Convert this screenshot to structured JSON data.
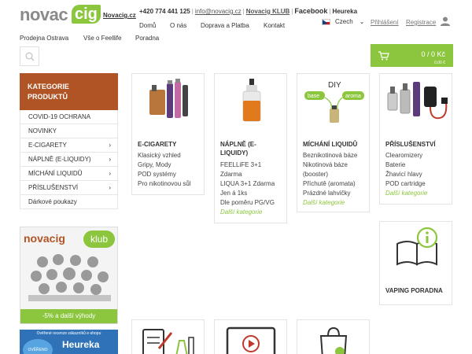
{
  "header": {
    "logo_text_a": "novac",
    "logo_text_b": "ig",
    "logo_caption": "Novacig.cz",
    "phone": "+420 774 441 125",
    "email": "info@novacig.cz",
    "klub_link": "Novacig KLUB",
    "facebook": "Facebook",
    "heureka": "Heureka",
    "nav": [
      "Domů",
      "O nás",
      "Doprava a Platba",
      "Kontakt"
    ],
    "subnav": [
      "Prodejna Ostrava",
      "Vše o Feellife",
      "Poradna"
    ],
    "language": "Czech",
    "login": "Přihlášení",
    "register": "Registrace",
    "cart_total": "0 / 0 Kč",
    "cart_sub": "0,00 €"
  },
  "sidebar": {
    "heading_line1": "KATEGORIE",
    "heading_line2": "PRODUKTŮ",
    "items": [
      {
        "label": "COVID-19 OCHRANA",
        "arrow": ""
      },
      {
        "label": "NOVINKY",
        "arrow": ""
      },
      {
        "label": "E-CIGARETY",
        "arrow": "›"
      },
      {
        "label": "NÁPLNĚ (E-LIQUIDY)",
        "arrow": "›"
      },
      {
        "label": "MÍCHÁNÍ LIQUIDŮ",
        "arrow": "›"
      },
      {
        "label": "PŘÍSLUŠENSTVÍ",
        "arrow": "›"
      },
      {
        "label": "Dárkové poukazy",
        "arrow": ""
      }
    ]
  },
  "banners": {
    "klub_logo": "novacig",
    "klub_pill": "klub",
    "klub_strip": "-5% a další výhody",
    "heureka_top": "Ověřené recenze zákazníků e-shopu",
    "heureka_name": "Heureka",
    "heureka_seal": "OVĚŘENO"
  },
  "cards": [
    {
      "title_line1": "E-CIGARETY",
      "title_line2": "",
      "items": [
        "Klasický vzhled",
        "Gripy, Mody",
        "POD systémy",
        "Pro nikotinovou sůl"
      ],
      "more": ""
    },
    {
      "title_line1": "NÁPLNĚ (E-",
      "title_line2": "LIQUIDY)",
      "items": [
        "FEELLiFE 3+1",
        "Zdarma",
        "LIQUA 3+1 Zdarma",
        "Jen á 1ks",
        "Dle poměru PG/VG"
      ],
      "more": "Další kategorie"
    },
    {
      "title_line1": "MÍCHÁNÍ LIQUIDŮ",
      "title_line2": "",
      "items": [
        "Beznikotinová báze",
        "Nikotinová báze",
        "(booster)",
        "Příchutě (aromata)",
        "Prázdné lahvičky"
      ],
      "more": "Další kategorie",
      "img_diy": "DIY",
      "img_base": "base",
      "img_aroma": "aroma"
    },
    {
      "title_line1": "PŘÍSLUŠENSTVÍ",
      "title_line2": "",
      "items": [
        "Clearomizery",
        "Baterie",
        "Žhavicí hlavy",
        "POD cartridge"
      ],
      "more": "Další kategorie"
    },
    {
      "title_line1": "VAPING PORADNA",
      "title_line2": "",
      "items": [],
      "more": ""
    }
  ],
  "colors": {
    "brand_green": "#8cc63f",
    "brand_brown": "#b05426"
  }
}
